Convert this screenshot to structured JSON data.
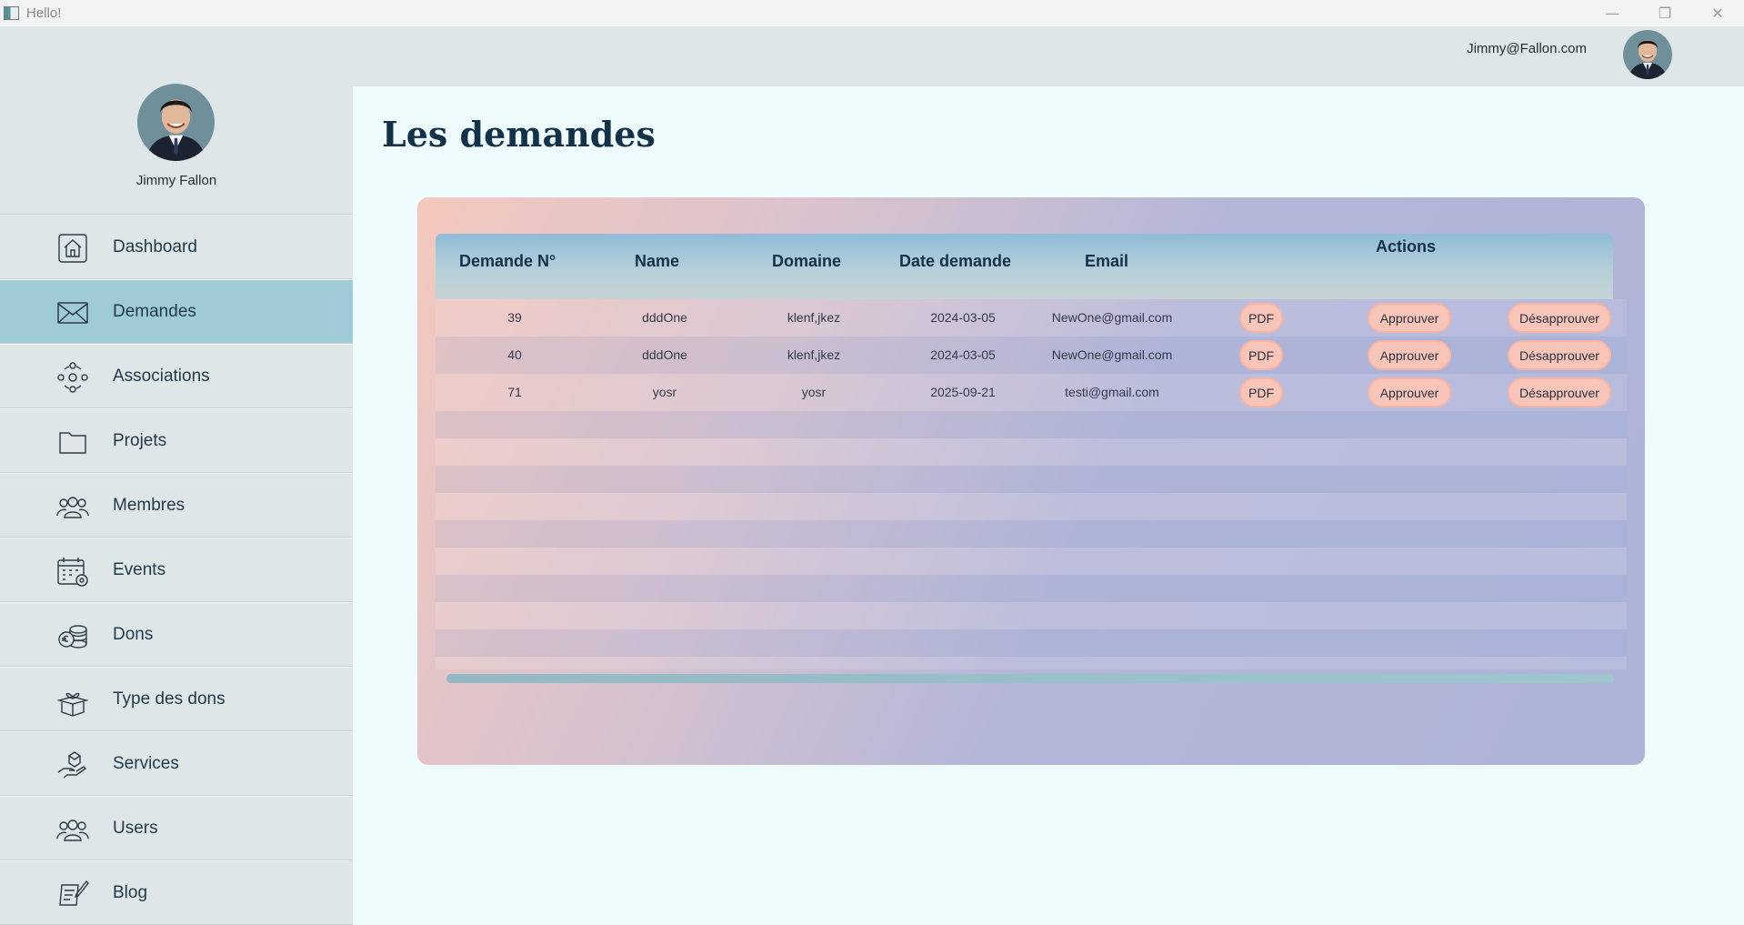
{
  "window": {
    "title": "Hello!",
    "controls": [
      "minimize-icon",
      "restore-icon",
      "close-icon"
    ]
  },
  "header": {
    "email": "Jimmy@Fallon.com"
  },
  "profile": {
    "name": "Jimmy Fallon"
  },
  "sidebar": {
    "items": [
      {
        "label": "Dashboard",
        "icon": "home-icon",
        "active": false
      },
      {
        "label": "Demandes",
        "icon": "mail-icon",
        "active": true
      },
      {
        "label": "Associations",
        "icon": "network-icon",
        "active": false
      },
      {
        "label": "Projets",
        "icon": "folder-icon",
        "active": false
      },
      {
        "label": "Membres",
        "icon": "group-icon",
        "active": false
      },
      {
        "label": "Events",
        "icon": "calendar-icon",
        "active": false
      },
      {
        "label": "Dons",
        "icon": "coins-icon",
        "active": false
      },
      {
        "label": "Type des dons",
        "icon": "gift-box-icon",
        "active": false
      },
      {
        "label": "Services",
        "icon": "hand-service-icon",
        "active": false
      },
      {
        "label": "Users",
        "icon": "users-icon",
        "active": false
      },
      {
        "label": "Blog",
        "icon": "blog-icon",
        "active": false
      }
    ]
  },
  "main": {
    "title": "Les demandes",
    "table": {
      "headers": {
        "number": "Demande N°",
        "name": "Name",
        "domain": "Domaine",
        "date": "Date demande",
        "email": "Email",
        "actions": "Actions"
      },
      "buttons": {
        "pdf": "PDF",
        "approve": "Approuver",
        "reject": "Désapprouver"
      },
      "rows": [
        {
          "number": "39",
          "name": "dddOne",
          "domain": "klenf,jkez",
          "date": "2024-03-05",
          "email": "NewOne@gmail.com"
        },
        {
          "number": "40",
          "name": "dddOne",
          "domain": "klenf,jkez",
          "date": "2024-03-05",
          "email": "NewOne@gmail.com"
        },
        {
          "number": "71",
          "name": "yosr",
          "domain": "yosr",
          "date": "2025-09-21",
          "email": "testi@gmail.com"
        }
      ]
    }
  },
  "colors": {
    "sidebar_bg": "#dfe6e8",
    "active_item": "#9fcbd6",
    "main_bg": "#eefcfe",
    "button_bg": "#f9c5b8",
    "title_color": "#13324a"
  }
}
